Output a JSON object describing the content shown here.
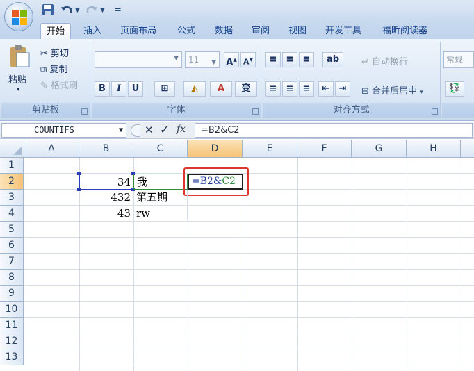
{
  "quick_access": {
    "save_icon": "save-icon",
    "undo_icon": "undo-icon",
    "redo_icon": "redo-icon",
    "separator": "="
  },
  "tabs": [
    "开始",
    "插入",
    "页面布局",
    "公式",
    "数据",
    "审阅",
    "视图",
    "开发工具",
    "福昕阅读器"
  ],
  "active_tab": "开始",
  "clipboard": {
    "paste": "粘贴",
    "cut": "剪切",
    "copy": "复制",
    "format_painter": "格式刷",
    "title": "剪贴板"
  },
  "font": {
    "size": "11",
    "bold": "B",
    "italic": "I",
    "underline": "U",
    "title": "字体"
  },
  "alignment": {
    "wrap_text": "自动换行",
    "merge_center": "合并后居中",
    "title": "对齐方式"
  },
  "number": {
    "format": "常规"
  },
  "formula_bar": {
    "name_box": "COUNTIFS",
    "formula": "=B2&C2",
    "fx": "fx"
  },
  "columns": [
    "A",
    "B",
    "C",
    "D",
    "E",
    "F",
    "G",
    "H"
  ],
  "rows": [
    "1",
    "2",
    "3",
    "4",
    "5",
    "6",
    "7",
    "8",
    "9",
    "10",
    "11",
    "12",
    "13"
  ],
  "cells": {
    "b2": "34",
    "c2": "我",
    "d2_part1": "=B2&",
    "d2_part2": "C2",
    "b3": "432",
    "c3": "第五期",
    "b4": "43",
    "c4": "rw"
  },
  "colors": {
    "accent": "#15428b",
    "highlight": "#d9372f",
    "ref_blue": "#1f3a9e",
    "ref_green": "#2f8a3b"
  }
}
